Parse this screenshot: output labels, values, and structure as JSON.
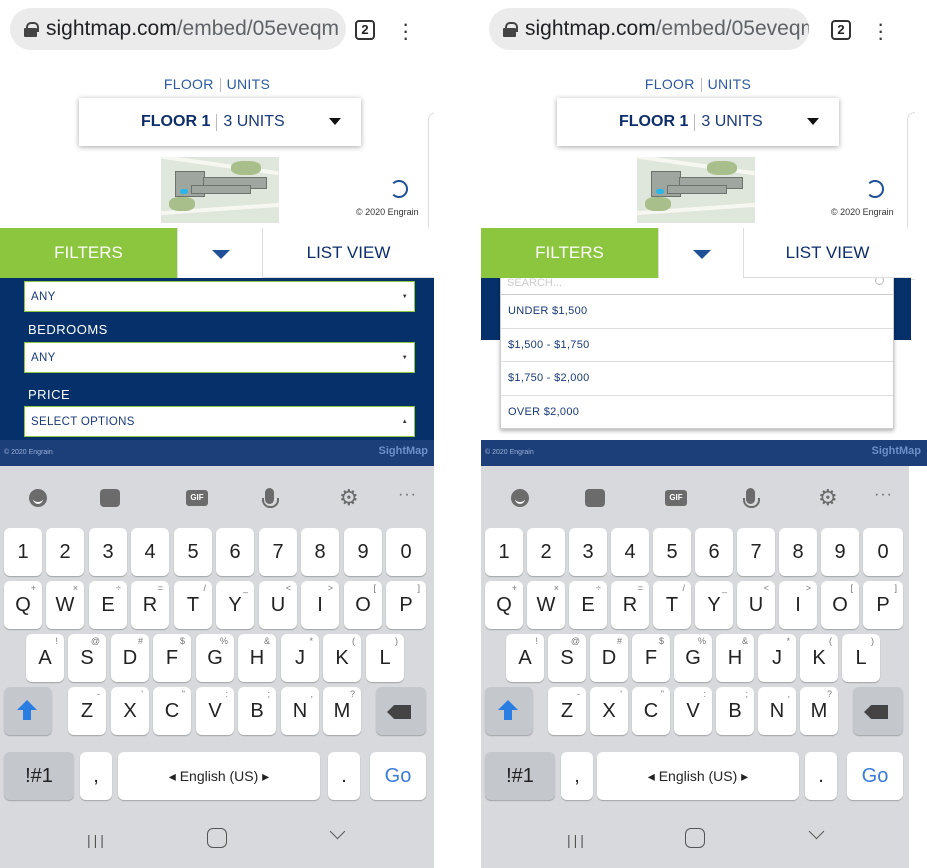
{
  "url": {
    "domain": "sightmap.com",
    "path": "/embed/05eveqm"
  },
  "tab_count": "2",
  "tabs_line": {
    "floor": "FLOOR",
    "units": "UNITS"
  },
  "floor_select": {
    "floor": "FLOOR 1",
    "units": "3 UNITS"
  },
  "copyright": "© 2020 Engrain",
  "buttons": {
    "filters": "FILTERS",
    "list_view": "LIST VIEW"
  },
  "left_filters": {
    "first_value": "ANY",
    "bedrooms_label": "BEDROOMS",
    "bedrooms_value": "ANY",
    "price_label": "PRICE",
    "price_value": "SELECT OPTIONS"
  },
  "price_dropdown": {
    "search_placeholder": "SEARCH...",
    "options": [
      "UNDER $1,500",
      "$1,500 - $1,750",
      "$1,750 - $2,000",
      "OVER $2,000"
    ]
  },
  "footer": {
    "copyright": "© 2020 Engrain",
    "logo": "SightMap"
  },
  "keyboard": {
    "numbers": [
      "1",
      "2",
      "3",
      "4",
      "5",
      "6",
      "7",
      "8",
      "9",
      "0"
    ],
    "row1": [
      "Q",
      "W",
      "E",
      "R",
      "T",
      "Y",
      "U",
      "I",
      "O",
      "P"
    ],
    "row1_sup": [
      "+",
      "×",
      "÷",
      "=",
      "/",
      "_",
      "<",
      ">",
      "[",
      "]"
    ],
    "row2": [
      "A",
      "S",
      "D",
      "F",
      "G",
      "H",
      "J",
      "K",
      "L"
    ],
    "row2_sup": [
      "!",
      "@",
      "#",
      "$",
      "%",
      "&",
      "*",
      "(",
      ")"
    ],
    "row3": [
      "Z",
      "X",
      "C",
      "V",
      "B",
      "N",
      "M"
    ],
    "row3_sup": [
      "-",
      "'",
      "\"",
      ":",
      ";",
      ",",
      "?"
    ],
    "symbols": "!#1",
    "comma": ",",
    "space": "◂ English (US) ▸",
    "period": ".",
    "go": "Go",
    "gif": "GIF",
    "more": "···"
  },
  "nav": {
    "recent": "|||"
  }
}
